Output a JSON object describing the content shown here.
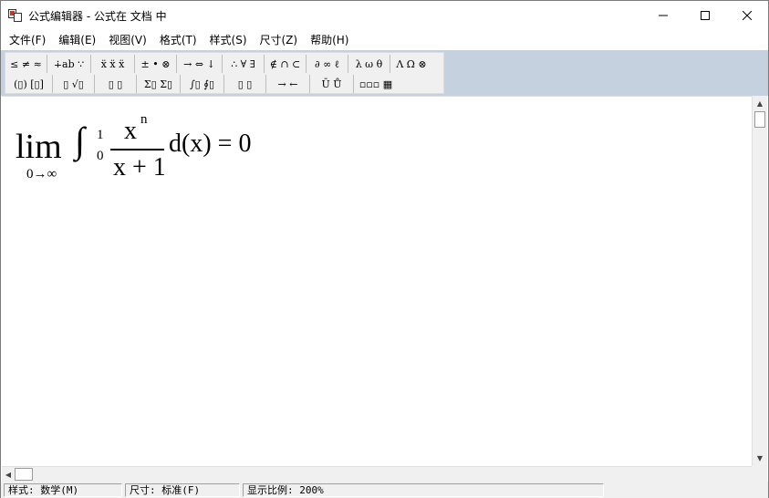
{
  "window": {
    "title": "公式编辑器 - 公式在 文档 中"
  },
  "menu": [
    {
      "label": "文件(F)"
    },
    {
      "label": "编辑(E)"
    },
    {
      "label": "视图(V)"
    },
    {
      "label": "格式(T)"
    },
    {
      "label": "样式(S)"
    },
    {
      "label": "尺寸(Z)"
    },
    {
      "label": "帮助(H)"
    }
  ],
  "toolbar": {
    "row1": [
      {
        "label": "≤ ≠ ≈",
        "icon": "relations-palette-icon"
      },
      {
        "label": "∔ab ∵",
        "icon": "spaces-ellipses-palette-icon"
      },
      {
        "label": "ẍ ẍ ẍ",
        "icon": "embellishments-palette-icon"
      },
      {
        "label": "± • ⊗",
        "icon": "operators-palette-icon"
      },
      {
        "label": "→ ⇔ ↓",
        "icon": "arrows-palette-icon"
      },
      {
        "label": "∴ ∀ ∃",
        "icon": "logic-palette-icon"
      },
      {
        "label": "∉ ∩ ⊂",
        "icon": "set-theory-palette-icon"
      },
      {
        "label": "∂ ∞ ℓ",
        "icon": "misc-symbols-palette-icon"
      },
      {
        "label": "λ ω θ",
        "icon": "greek-lowercase-palette-icon"
      },
      {
        "label": "Λ Ω ⊗",
        "icon": "greek-uppercase-palette-icon"
      }
    ],
    "row2": [
      {
        "label": "(▯) [▯]",
        "icon": "fences-palette-icon"
      },
      {
        "label": "▯ √▯",
        "icon": "fractions-radicals-palette-icon"
      },
      {
        "label": "▯ ▯",
        "icon": "subscript-superscript-palette-icon"
      },
      {
        "label": "Σ▯ Σ▯",
        "icon": "summation-palette-icon"
      },
      {
        "label": "∫▯ ∮▯",
        "icon": "integral-palette-icon"
      },
      {
        "label": "▯ ▯",
        "icon": "underbar-overbar-palette-icon"
      },
      {
        "label": "→ ←",
        "icon": "labeled-arrows-palette-icon"
      },
      {
        "label": "Ū Ů",
        "icon": "products-palette-icon"
      },
      {
        "label": "▫▫▫ ▦",
        "icon": "matrix-palette-icon"
      }
    ]
  },
  "formula": {
    "lim": "lim",
    "lim_sub": "0→∞",
    "integral": "∫",
    "upper": "1",
    "lower": "0",
    "numerator": "x",
    "exponent": "n",
    "denominator": "x + 1",
    "rest": "d(x) = 0"
  },
  "status": {
    "style": "样式: 数学(M)",
    "size": "尺寸: 标准(F)",
    "zoom": "显示比例: 200%"
  }
}
